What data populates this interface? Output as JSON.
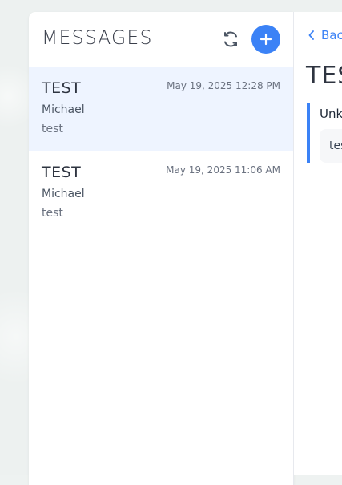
{
  "messages_panel": {
    "title": "MESSAGES",
    "refresh_icon": "refresh-icon",
    "compose_icon": "plus-icon",
    "accent_color": "#3b82f6",
    "items": [
      {
        "subject": "TEST",
        "date": "May 19, 2025 12:28 PM",
        "from": "Michael",
        "preview": "test",
        "selected": true
      },
      {
        "subject": "TEST",
        "date": "May 19, 2025 11:06 AM",
        "from": "Michael",
        "preview": "test",
        "selected": false
      }
    ]
  },
  "detail": {
    "back_label": "Bac",
    "back_icon": "chevron-left-icon",
    "subject": "TES",
    "sender": "Unk",
    "body": "tes"
  }
}
